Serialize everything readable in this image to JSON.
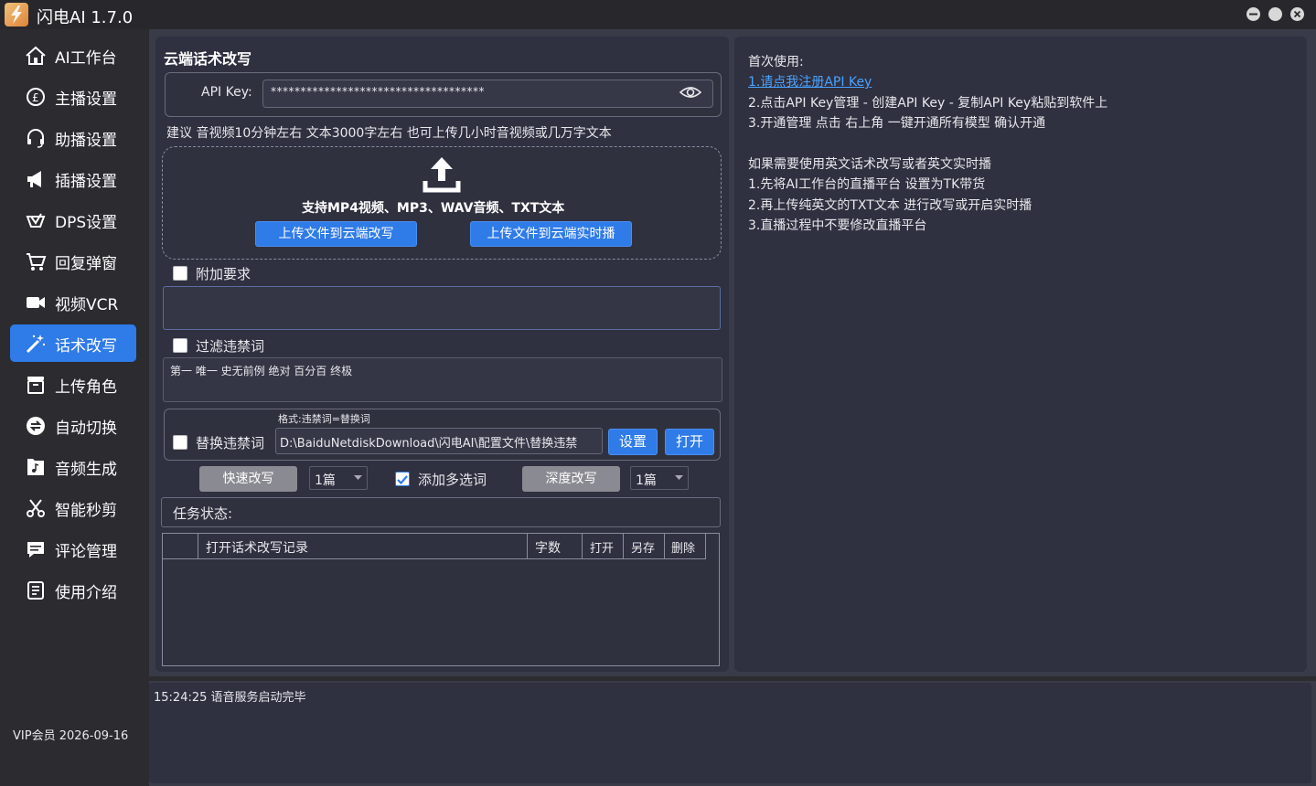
{
  "window": {
    "title": "闪电AI 1.7.0",
    "controls": [
      "minimize-icon",
      "maximize-icon",
      "close-icon"
    ]
  },
  "sidebar": {
    "items": [
      {
        "label": "AI工作台",
        "icon": "home-icon"
      },
      {
        "label": "主播设置",
        "icon": "anchor-icon"
      },
      {
        "label": "助播设置",
        "icon": "headset-icon"
      },
      {
        "label": "插播设置",
        "icon": "megaphone-icon"
      },
      {
        "label": "DPS设置",
        "icon": "dps-icon"
      },
      {
        "label": "回复弹窗",
        "icon": "cart-icon"
      },
      {
        "label": "视频VCR",
        "icon": "video-camera-icon"
      },
      {
        "label": "话术改写",
        "icon": "magic-wand-icon",
        "active": true
      },
      {
        "label": "上传角色",
        "icon": "box-icon"
      },
      {
        "label": "自动切换",
        "icon": "switch-icon"
      },
      {
        "label": "音频生成",
        "icon": "music-file-icon"
      },
      {
        "label": "智能秒剪",
        "icon": "scissors-icon"
      },
      {
        "label": "评论管理",
        "icon": "comment-icon"
      },
      {
        "label": "使用介绍",
        "icon": "document-icon"
      }
    ],
    "vip": "VIP会员  2026-09-16"
  },
  "rewrite": {
    "title": "云端话术改写",
    "api_label": "API Key:",
    "api_value": "************************************",
    "hint": "建议 音视频10分钟左右 文本3000字左右    也可上传几小时音视频或几万字文本",
    "upload_desc": "支持MP4视频、MP3、WAV音频、TXT文本",
    "upload_rewrite_btn": "上传文件到云端改写",
    "upload_live_btn": "上传文件到云端实时播",
    "extra_label": "附加要求",
    "extra_value": "",
    "filter_label": "过滤违禁词",
    "filter_words": "第一 唯一 史无前例 绝对 百分百 终极",
    "replace_format": "格式:违禁词=替换词",
    "replace_label": "替换违禁词",
    "replace_path": "D:\\BaiduNetdiskDownload\\闪电AI\\配置文件\\替换违禁",
    "set_btn": "设置",
    "open_btn": "打开",
    "fast_btn": "快速改写",
    "fast_count": "1篇",
    "multi_label": "添加多选词",
    "multi_checked": true,
    "deep_btn": "深度改写",
    "deep_count": "1篇",
    "status_label": "任务状态:",
    "table_headers": [
      "",
      "打开话术改写记录",
      "字数",
      "打开",
      "另存",
      "删除"
    ]
  },
  "info": {
    "lines": [
      "首次使用:",
      "1.请点我注册API Key",
      "2.点击API Key管理 - 创建API Key - 复制API Key粘贴到软件上",
      "3.开通管理 点击 右上角 一键开通所有模型  确认开通",
      "",
      "如果需要使用英文话术改写或者英文实时播",
      "1.先将AI工作台的直播平台 设置为TK带货",
      "2.再上传纯英文的TXT文本 进行改写或开启实时播",
      "3.直播过程中不要修改直播平台"
    ]
  },
  "log": {
    "text": "15:24:25 语音服务启动完毕"
  },
  "colors": {
    "accent": "#2f7be8",
    "link": "#4aa3ff",
    "panel": "#2f3040",
    "background": "#2b2b30"
  }
}
